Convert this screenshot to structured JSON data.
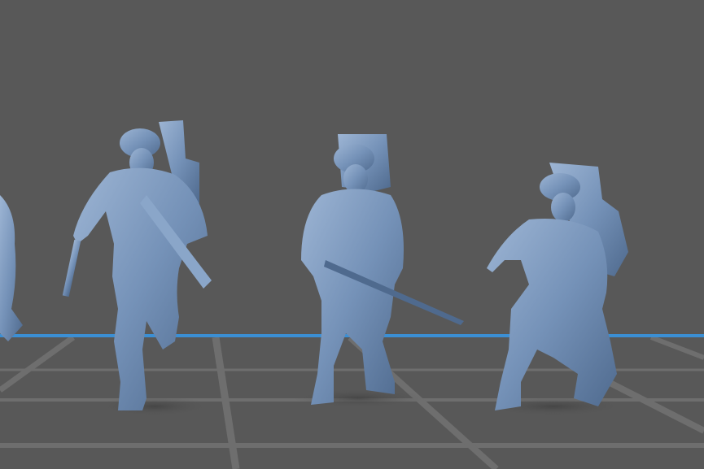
{
  "scene": {
    "background_color": "#585858",
    "floor_line_color": "#6e6e6e",
    "axis_line_color": "#3b8fd4",
    "figure_color": "#7592b8",
    "figure_shadow_color": "#4f6a8e",
    "figure_highlight_color": "#9db5d4",
    "figures": [
      {
        "name": "partial-figure-left"
      },
      {
        "name": "running-soldier-with-launcher"
      },
      {
        "name": "walking-soldier-with-rifle"
      },
      {
        "name": "crouching-soldier"
      }
    ]
  }
}
